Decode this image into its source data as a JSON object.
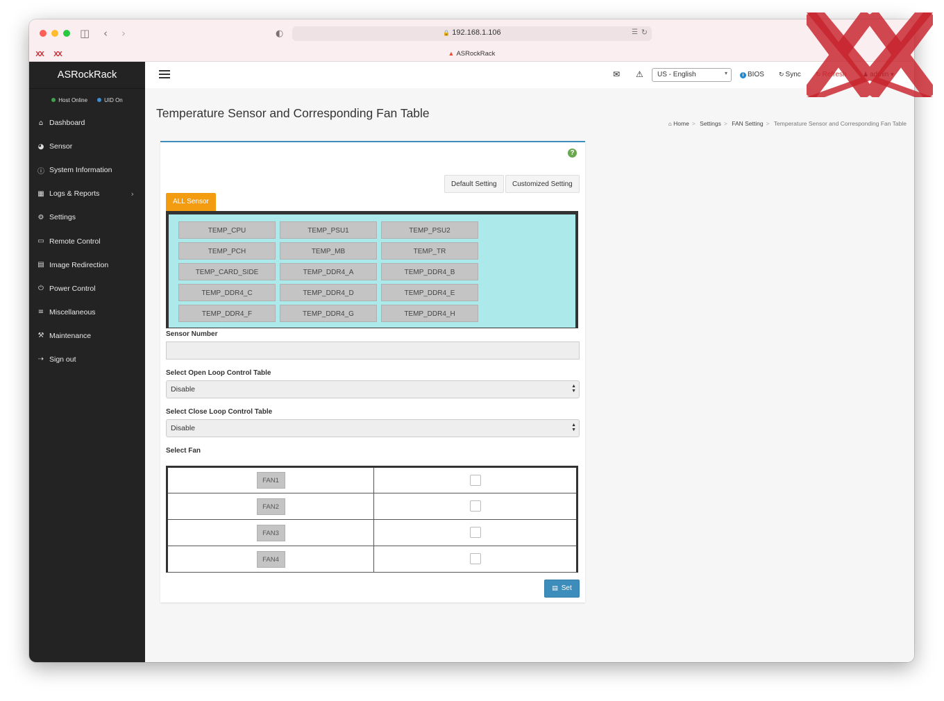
{
  "browser": {
    "url": "192.168.1.106",
    "tab_title": "ASRockRack",
    "pinned_tabs": [
      "XX",
      "XX"
    ],
    "icons": [
      "sidebar-toggle-icon",
      "back-icon",
      "forward-icon",
      "shield-icon",
      "lock-icon",
      "translate-icon",
      "reload-icon",
      "download-icon",
      "share-icon",
      "new-tab-icon",
      "tab-overview-icon"
    ]
  },
  "sidebar": {
    "brand": "ASRockRack",
    "status": [
      {
        "label": "Host Online",
        "color": "#3fa14f"
      },
      {
        "label": "UID On",
        "color": "#3a8fd6"
      }
    ],
    "items": [
      {
        "label": "Dashboard",
        "icon": "home-icon"
      },
      {
        "label": "Sensor",
        "icon": "dashboard-gauge-icon"
      },
      {
        "label": "System Information",
        "icon": "info-circle-icon"
      },
      {
        "label": "Logs & Reports",
        "icon": "bar-chart-icon"
      },
      {
        "label": "Settings",
        "icon": "gear-icon"
      },
      {
        "label": "Remote Control",
        "icon": "desktop-icon"
      },
      {
        "label": "Image Redirection",
        "icon": "hdd-icon"
      },
      {
        "label": "Power Control",
        "icon": "power-icon"
      },
      {
        "label": "Miscellaneous",
        "icon": "list-icon"
      },
      {
        "label": "Maintenance",
        "icon": "wrench-icon"
      },
      {
        "label": "Sign out",
        "icon": "sign-out-icon"
      }
    ]
  },
  "header": {
    "language": "US - English",
    "bios": "BIOS",
    "sync": "Sync",
    "refresh": "Refresh",
    "user": "admin"
  },
  "page": {
    "title": "Temperature Sensor and Corresponding Fan Table",
    "breadcrumb": [
      "Home",
      "Settings",
      "FAN Setting",
      "Temperature Sensor and Corresponding Fan Table"
    ],
    "default_setting": "Default Setting",
    "customized_setting": "Customized Setting",
    "all_sensor": "ALL Sensor",
    "sensors": [
      "TEMP_CPU",
      "TEMP_PSU1",
      "TEMP_PSU2",
      "TEMP_PCH",
      "TEMP_MB",
      "TEMP_TR",
      "TEMP_CARD_SIDE",
      "TEMP_DDR4_A",
      "TEMP_DDR4_B",
      "TEMP_DDR4_C",
      "TEMP_DDR4_D",
      "TEMP_DDR4_E",
      "TEMP_DDR4_F",
      "TEMP_DDR4_G",
      "TEMP_DDR4_H"
    ],
    "sensor_number_label": "Sensor Number",
    "sensor_number_value": "",
    "open_loop_label": "Select Open Loop Control Table",
    "open_loop_value": "Disable",
    "close_loop_label": "Select Close Loop Control Table",
    "close_loop_value": "Disable",
    "select_fan_label": "Select Fan",
    "fans": [
      {
        "label": "FAN1",
        "checked": false
      },
      {
        "label": "FAN2",
        "checked": false
      },
      {
        "label": "FAN3",
        "checked": false
      },
      {
        "label": "FAN4",
        "checked": false
      }
    ],
    "set_button": "Set"
  },
  "colors": {
    "accent": "#3c8dbc",
    "orange": "#f39c12",
    "sensor_bg": "#ace9eb",
    "sidebar_bg": "#232323"
  }
}
